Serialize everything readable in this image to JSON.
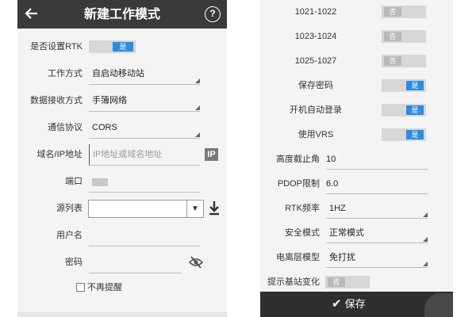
{
  "left_panel": {
    "header": {
      "back_icon": "arrow-left-icon",
      "title": "新建工作模式",
      "help_label": "?"
    },
    "rtk": {
      "label": "是否设置RTK",
      "value": "是"
    },
    "work_mode": {
      "label": "工作方式",
      "value": "自启动移动站"
    },
    "data_receive": {
      "label": "数据接收方式",
      "value": "手簿网络"
    },
    "protocol": {
      "label": "通信协议",
      "value": "CORS"
    },
    "domain": {
      "label": "域名/IP地址",
      "placeholder": "IP地址或域名地址",
      "ip_button": "IP"
    },
    "port": {
      "label": "端口"
    },
    "source_table": {
      "label": "源列表",
      "dropdown_icon": "triangle-down-icon",
      "download_icon": "download-icon"
    },
    "username": {
      "label": "用户名"
    },
    "password": {
      "label": "密码",
      "visibility_icon": "eye-off-icon"
    },
    "no_remind": {
      "label": "不再提醒"
    }
  },
  "right_panel": {
    "r1": {
      "label": "1021-1022",
      "value": "否"
    },
    "r2": {
      "label": "1023-1024",
      "value": "否"
    },
    "r3": {
      "label": "1025-1027",
      "value": "否"
    },
    "save_password": {
      "label": "保存密码",
      "value": "是"
    },
    "auto_login": {
      "label": "开机自动登录",
      "value": "是"
    },
    "use_vrs": {
      "label": "使用VRS",
      "value": "是"
    },
    "elevation": {
      "label": "高度截止角",
      "value": "10"
    },
    "pdop": {
      "label": "PDOP限制",
      "value": "6.0"
    },
    "rtk_freq": {
      "label": "RTK频率",
      "value": "1HZ"
    },
    "safe_mode": {
      "label": "安全模式",
      "value": "正常模式"
    },
    "ionosphere": {
      "label": "电离层模型",
      "value": "免打扰"
    },
    "base_change": {
      "label": "提示基站变化",
      "value": "否"
    },
    "save": {
      "label": "保存",
      "icon": "check-icon"
    }
  },
  "colors": {
    "header_bg": "#3a3a3a",
    "toggle_on": "#2f8ce0",
    "toggle_off": "#b9b9b9",
    "save_bar": "#2e2e2e"
  }
}
